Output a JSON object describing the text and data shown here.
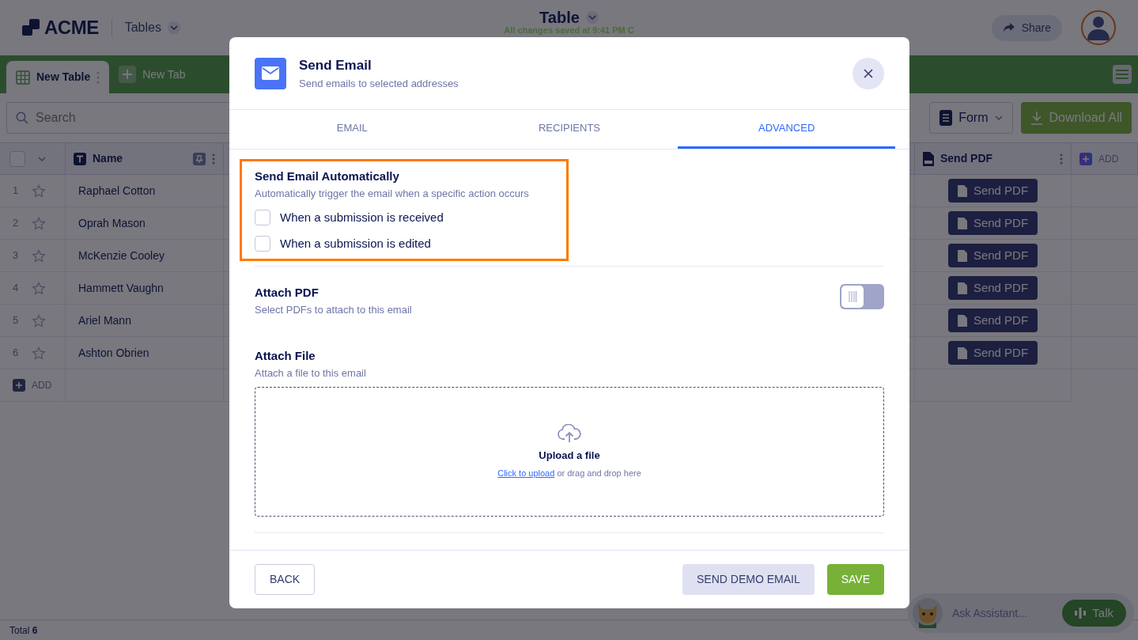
{
  "app": {
    "logo": "ACME",
    "section": "Tables",
    "doc_title": "Table",
    "save_status": "All changes saved at 9:41 PM C",
    "share": "Share"
  },
  "tabs": [
    {
      "label": "New Table",
      "kind": "table",
      "selected": true
    },
    {
      "label": "New Tab",
      "kind": "add",
      "selected": false
    }
  ],
  "toolbar": {
    "search_placeholder": "Search",
    "view": "Form",
    "download": "Download All"
  },
  "table": {
    "all_selected": false,
    "columns": [
      {
        "label": "Name",
        "kind": "text"
      },
      {
        "label": "Send PDF",
        "kind": "pdf"
      }
    ],
    "add_column": "ADD",
    "rows": [
      {
        "index": "1",
        "name": "Raphael Cotton",
        "starred": false,
        "action": "Send PDF"
      },
      {
        "index": "2",
        "name": "Oprah Mason",
        "starred": false,
        "action": "Send PDF"
      },
      {
        "index": "3",
        "name": "McKenzie Cooley",
        "starred": false,
        "action": "Send PDF"
      },
      {
        "index": "4",
        "name": "Hammett Vaughn",
        "starred": false,
        "action": "Send PDF"
      },
      {
        "index": "5",
        "name": "Ariel Mann",
        "starred": false,
        "action": "Send PDF"
      },
      {
        "index": "6",
        "name": "Ashton Obrien",
        "starred": false,
        "action": "Send PDF"
      }
    ],
    "add_row": "ADD",
    "total_label": "Total",
    "total": "6"
  },
  "modal": {
    "title": "Send Email",
    "subtitle": "Send emails to selected addresses",
    "tabs": [
      {
        "label": "EMAIL",
        "selected": false
      },
      {
        "label": "RECIPIENTS",
        "selected": false
      },
      {
        "label": "ADVANCED",
        "selected": true
      }
    ],
    "sections": [
      {
        "kind": "checks",
        "highlighted": true,
        "title": "Send Email Automatically",
        "subtitle": "Automatically trigger the email when a specific action occurs",
        "options": [
          {
            "label": "When a submission is received",
            "checked": false
          },
          {
            "label": "When a submission is edited",
            "checked": false
          }
        ]
      },
      {
        "kind": "toggle",
        "title": "Attach PDF",
        "subtitle": "Select PDFs to attach to this email",
        "on": false
      },
      {
        "kind": "upload",
        "title": "Attach File",
        "subtitle": "Attach a file to this email",
        "heading": "Upload a file",
        "link": "Click to upload",
        "hint": "or drag and drop here"
      }
    ],
    "buttons": {
      "back": "BACK",
      "demo": "SEND DEMO EMAIL",
      "save": "SAVE"
    }
  },
  "assistant": {
    "placeholder": "Ask Assistant...",
    "talk": "Talk"
  }
}
